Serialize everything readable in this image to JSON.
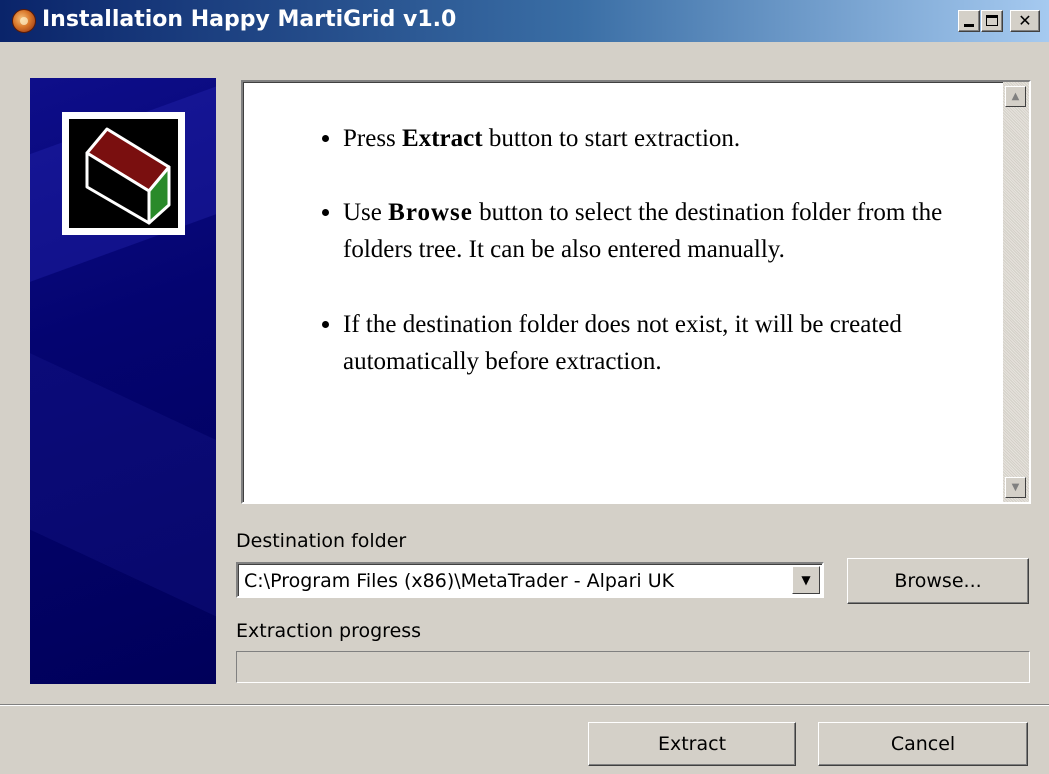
{
  "window": {
    "title": "Installation Happy MartiGrid v1.0",
    "icon": "installer-app-icon",
    "controls": {
      "minimize": "minimize-icon",
      "maximize": "maximize-icon",
      "close": "✕"
    }
  },
  "side_panel": {
    "logo": "package-box-logo"
  },
  "instructions": {
    "items": [
      {
        "pre": "Press ",
        "bold": "Extract",
        "post": " button to start extraction."
      },
      {
        "pre": "Use ",
        "bold": "Browse",
        "post": " button to select the destination folder from the folders tree. It can be also entered manually."
      },
      {
        "pre": "",
        "bold": "",
        "post": "If the destination folder does not exist, it will be created automatically before extraction."
      }
    ]
  },
  "destination": {
    "label": "Destination folder",
    "value": "C:\\Program Files (x86)\\MetaTrader - Alpari UK",
    "browse_label": "Browse..."
  },
  "progress": {
    "label": "Extraction progress",
    "value": 0
  },
  "buttons": {
    "extract_label": "Extract",
    "cancel_label": "Cancel"
  },
  "colors": {
    "titlebar_start": "#0a246a",
    "titlebar_end": "#a6caf0",
    "dialog_bg": "#d4d0c8",
    "side_panel": "#040470",
    "logo_red": "#7a0f0f",
    "logo_green": "#2a8a2a"
  }
}
